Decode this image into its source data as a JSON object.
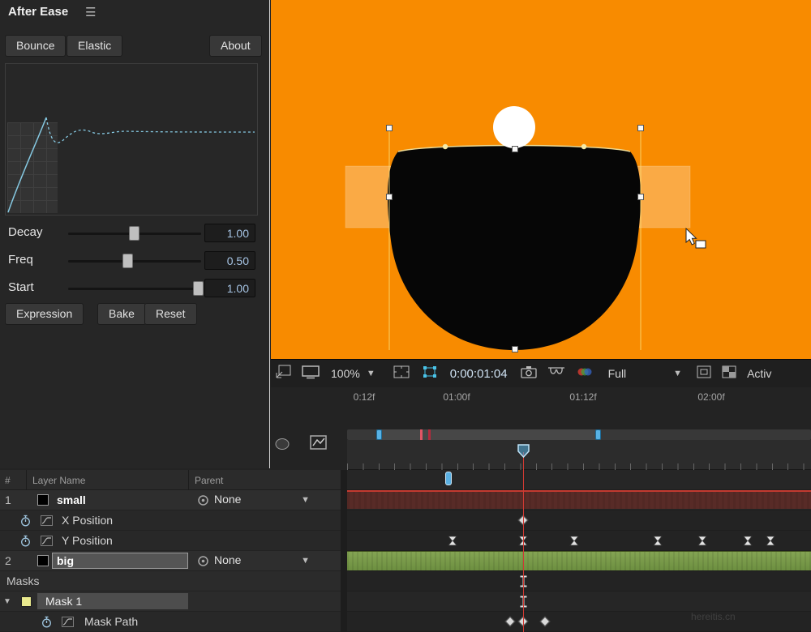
{
  "watermark": "hereitis.cn",
  "after_ease": {
    "title": "After Ease",
    "tab_bounce": "Bounce",
    "tab_elastic": "Elastic",
    "about": "About",
    "sliders": [
      {
        "label": "Decay",
        "value": "1.00"
      },
      {
        "label": "Freq",
        "value": "0.50"
      },
      {
        "label": "Start",
        "value": "1.00"
      }
    ],
    "buttons": {
      "expression": "Expression",
      "bake": "Bake",
      "reset": "Reset"
    }
  },
  "comp_toolbar": {
    "zoom": "100%",
    "timecode": "0:00:01:04",
    "resolution": "Full",
    "active": "Activ"
  },
  "timeline": {
    "columns": {
      "index": "#",
      "layer_name": "Layer Name",
      "parent": "Parent"
    },
    "ruler": [
      "0:12f",
      "01:00f",
      "01:12f",
      "02:00f"
    ],
    "layer1": {
      "index": "1",
      "name": "small",
      "parent": "None"
    },
    "layer2": {
      "index": "2",
      "name": "big",
      "parent": "None"
    },
    "prop_x": "X Position",
    "prop_y": "Y Position",
    "masks": "Masks",
    "mask1": "Mask 1",
    "mask_path": "Mask Path"
  }
}
